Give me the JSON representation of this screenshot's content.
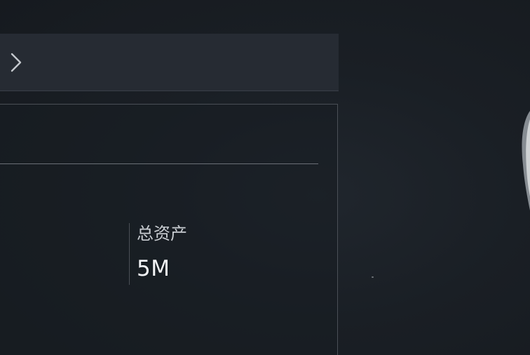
{
  "header": {
    "nav_icon": "chevron-right-icon"
  },
  "stats": {
    "total_assets_label": "总资产",
    "total_assets_value": "5M"
  },
  "colors": {
    "background": "#1a1f25",
    "top_bar": "#262b33",
    "panel_border": "#4a4f56",
    "divider": "#6b7077",
    "label_text": "#c9cdd2",
    "value_text": "#f2f4f6"
  }
}
